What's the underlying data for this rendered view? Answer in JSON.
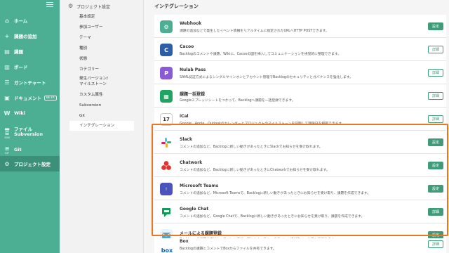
{
  "sidebar": {
    "items": [
      {
        "label": "ホーム",
        "icon": "home-icon"
      },
      {
        "label": "課題の追加",
        "icon": "plus-icon"
      },
      {
        "label": "課題",
        "icon": "list-icon"
      },
      {
        "label": "ボード",
        "icon": "board-icon"
      },
      {
        "label": "ガントチャート",
        "icon": "gantt-icon"
      },
      {
        "label": "ドキュメント",
        "icon": "document-icon",
        "badge": "BETA"
      },
      {
        "label": "Wiki",
        "icon": "wiki-icon"
      },
      {
        "label": "ファイル",
        "icon": "folder-icon"
      },
      {
        "label": "Subversion",
        "icon": "subversion-icon",
        "sub": "SVN"
      },
      {
        "label": "Git",
        "icon": "git-icon",
        "sub": "GIT"
      },
      {
        "label": "プロジェクト設定",
        "icon": "gear-icon"
      }
    ]
  },
  "submenu": {
    "title": "プロジェクト設定",
    "items": [
      "基本設定",
      "参加ユーザー",
      "テーマ",
      "種別",
      "状態",
      "カテゴリー",
      "発生バージョン/\nマイルストーン",
      "カスタム属性",
      "Subversion",
      "Git",
      "インテグレーション"
    ]
  },
  "main": {
    "title": "インテグレーション",
    "integrations": [
      {
        "name": "Webhook",
        "desc": "課題の追加などで発生したイベント情報をリアルタイムに指定されたURLへHTTP POSTできます。",
        "button": "設定",
        "color": "#4caf93"
      },
      {
        "name": "Cacoo",
        "desc": "Backlogのコメントや課題、Wikiに、Cacooの図を挿入してコミュニケーションを視覚的に整理できます。",
        "button": "詳細",
        "color": "#2d5fa8"
      },
      {
        "name": "Nulab Pass",
        "desc": "SAML認証方式によるシングルサインオンとアカウント管理でBacklogのセキュリティとガバナンスを強化します。",
        "button": "詳細",
        "color": "#8a5bd6"
      },
      {
        "name": "課題一括登録",
        "desc": "Googleスプレッドシートをつかって、Backlogへ課題を一括登録できます。",
        "button": "詳細",
        "color": "#1fa463"
      },
      {
        "name": "iCal",
        "desc": "Google、Apple、Outlookのカレンダーとプロジェクトのマイルストーンを同期して期限日を把握できます。",
        "button": "詳細",
        "color": "#ffffff"
      },
      {
        "name": "Slack",
        "desc": "コメントの追加など、Backlogに新しい動きがあったときにSlackでお知らせを受け取れます。",
        "button": "設定",
        "color": "#ffffff"
      },
      {
        "name": "Chatwork",
        "desc": "コメントの追加など、Backlogに新しい動きがあったときにChatworkでお知らせを受け取れます。",
        "button": "設定",
        "color": "#ffffff"
      },
      {
        "name": "Microsoft Teams",
        "desc": "コメントの追加など、Microsoft Teamsで、Backlogに新しい動きがあったときにお知らせを受け取り、課題を作成できます。",
        "button": "設定",
        "color": "#4b53bc"
      },
      {
        "name": "Google Chat",
        "desc": "コメントの追加など、Google Chatで、Backlogに新しい動きがあったときにお知らせを受け取り、課題を作成できます。",
        "button": "詳細",
        "color": "#ffffff"
      },
      {
        "name": "メールによる課題登録",
        "desc": "Backlogへの課題の追加や、コメント追加、プルリクエストへのコメント追加をメール経由で行えます。",
        "button": "設定",
        "color": "#e6f3fb"
      },
      {
        "name": "Box",
        "desc": "Backlogの課題とコメントでBoxからファイルを共有できます。",
        "button": "詳細",
        "color": "#ffffff"
      }
    ]
  }
}
